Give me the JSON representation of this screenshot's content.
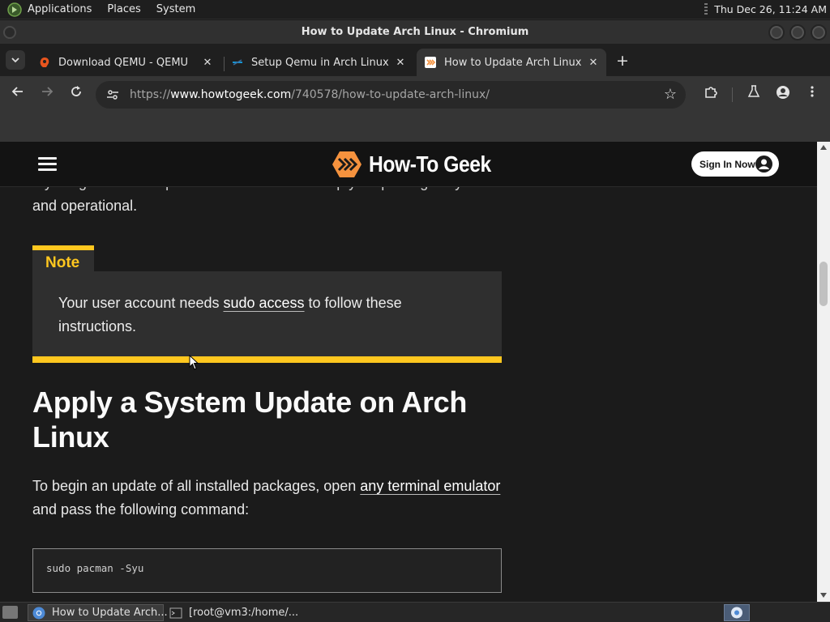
{
  "top_panel": {
    "menus": [
      "Applications",
      "Places",
      "System"
    ],
    "clock": "Thu Dec 26, 11:24 AM"
  },
  "window": {
    "title": "How to Update Arch Linux - Chromium"
  },
  "tabs": [
    {
      "title": "Download QEMU - QEMU",
      "favicon": "qemu-icon",
      "active": false
    },
    {
      "title": "Setup Qemu in Arch Linux",
      "favicon": "arch-icon",
      "active": false
    },
    {
      "title": "How to Update Arch Linux",
      "favicon": "howtogeek-icon",
      "active": true
    }
  ],
  "toolbar": {
    "url_prefix": "https://",
    "url_host": "www.howtogeek.com",
    "url_path": "/740578/how-to-update-arch-linux/"
  },
  "site": {
    "brand": "How-To Geek",
    "sign_in": "Sign In Now"
  },
  "article": {
    "intro_fragment": "“syncing.” You’ll use pacman commands to keep your packages synced",
    "intro_end": "and operational.",
    "note": {
      "label": "Note",
      "text_before": "Your user account needs ",
      "link": "sudo access",
      "text_after": " to follow these instructions."
    },
    "heading": "Apply a System Update on Arch Linux",
    "para_before": "To begin an update of all installed packages, open ",
    "para_link": "any terminal emulator",
    "para_after": " and pass the following command:",
    "code": "sudo pacman -Syu"
  },
  "taskbar": {
    "tasks": [
      {
        "label": "How to Update Arch...",
        "icon": "chromium-icon",
        "active": true
      },
      {
        "label": "[root@vm3:/home/...",
        "icon": "terminal-icon",
        "active": false
      }
    ]
  },
  "colors": {
    "accent_yellow": "#ffc71f",
    "brand_orange": "#f5923e",
    "page_background": "#1b1b1b"
  }
}
